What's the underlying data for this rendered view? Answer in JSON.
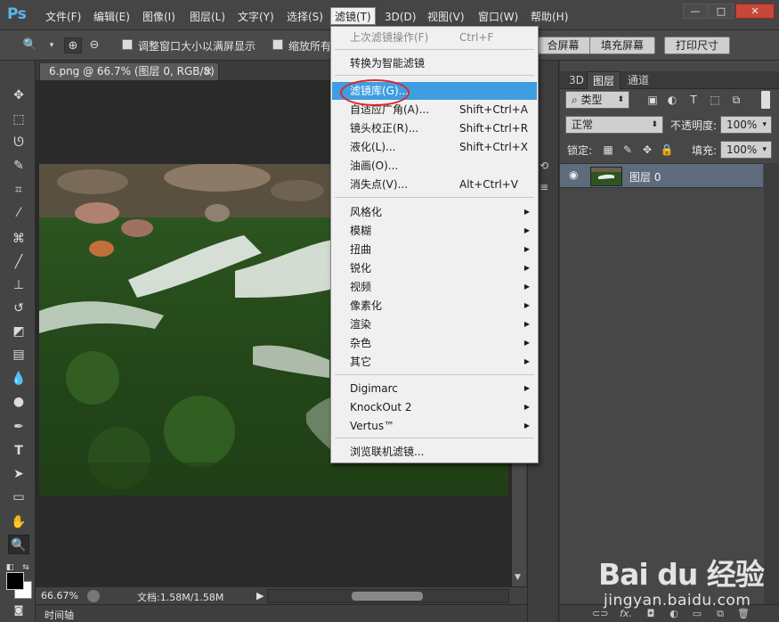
{
  "app": {
    "logo": "Ps"
  },
  "menubar": {
    "items": [
      "文件(F)",
      "编辑(E)",
      "图像(I)",
      "图层(L)",
      "文字(Y)",
      "选择(S)",
      "滤镜(T)",
      "3D(D)",
      "视图(V)",
      "窗口(W)",
      "帮助(H)"
    ],
    "active": "滤镜(T)"
  },
  "options": {
    "fit_window_label": "调整窗口大小以满屏显示",
    "zoom_all_label": "缩放所有",
    "fit_screen_label": "合屏幕",
    "fill_screen_label": "填充屏幕",
    "print_size_label": "打印尺寸"
  },
  "document": {
    "tab_title": "6.png @ 66.7% (图层 0, RGB/8)",
    "tab_close": "×",
    "zoom": "66.67%",
    "doc_info": "文档:1.58M/1.58M"
  },
  "timeline": {
    "label": "时间轴"
  },
  "filter_menu": {
    "items": [
      {
        "label": "上次滤镜操作(F)",
        "shortcut": "Ctrl+F",
        "disabled": true
      },
      {
        "label": "转换为智能滤镜",
        "shortcut": ""
      },
      {
        "label": "滤镜库(G)...",
        "shortcut": "",
        "highlight": true
      },
      {
        "label": "自适应广角(A)...",
        "shortcut": "Shift+Ctrl+A"
      },
      {
        "label": "镜头校正(R)...",
        "shortcut": "Shift+Ctrl+R"
      },
      {
        "label": "液化(L)...",
        "shortcut": "Shift+Ctrl+X"
      },
      {
        "label": "油画(O)...",
        "shortcut": ""
      },
      {
        "label": "消失点(V)...",
        "shortcut": "Alt+Ctrl+V"
      },
      {
        "label": "风格化",
        "submenu": true
      },
      {
        "label": "模糊",
        "submenu": true
      },
      {
        "label": "扭曲",
        "submenu": true
      },
      {
        "label": "锐化",
        "submenu": true
      },
      {
        "label": "视频",
        "submenu": true
      },
      {
        "label": "像素化",
        "submenu": true
      },
      {
        "label": "渲染",
        "submenu": true
      },
      {
        "label": "杂色",
        "submenu": true
      },
      {
        "label": "其它",
        "submenu": true
      },
      {
        "label": "Digimarc",
        "submenu": true
      },
      {
        "label": "KnockOut 2",
        "submenu": true
      },
      {
        "label": "Vertus™",
        "submenu": true
      },
      {
        "label": "浏览联机滤镜..."
      }
    ]
  },
  "layers_panel": {
    "tabs": [
      "3D",
      "图层",
      "通道"
    ],
    "active_tab": "图层",
    "filter_kind": "类型",
    "blend_mode": "正常",
    "opacity_label": "不透明度:",
    "opacity_value": "100%",
    "lock_label": "锁定:",
    "fill_label": "填充:",
    "fill_value": "100%",
    "layers": [
      {
        "name": "图层 0",
        "visible": true
      }
    ],
    "footer_fx": "fx."
  },
  "watermark": {
    "brand": "Bai du 经验",
    "sub": "jingyan.baidu.com"
  },
  "colors": {
    "accent": "#3f9de2",
    "highlight_circle": "#e0242a",
    "foreground_swatch": "#000000",
    "background_swatch": "#ffffff"
  }
}
